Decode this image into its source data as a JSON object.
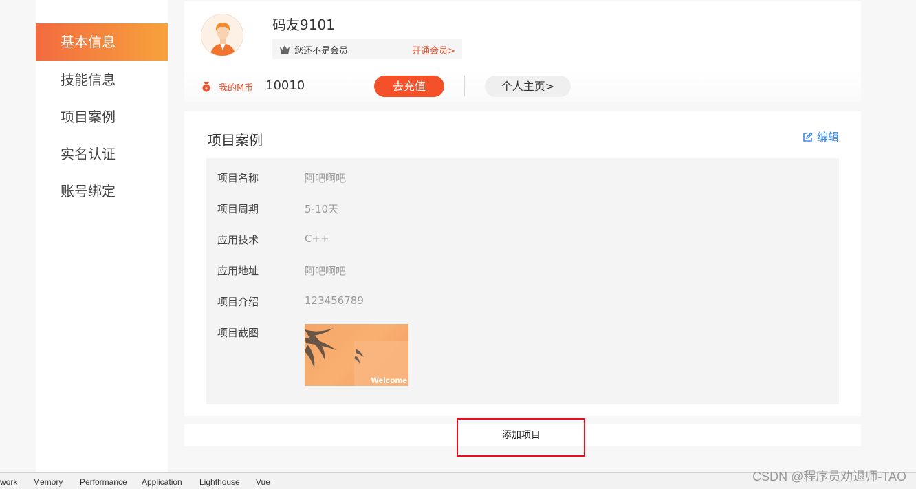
{
  "sidebar": {
    "items": [
      {
        "label": "基本信息",
        "active": true
      },
      {
        "label": "技能信息",
        "active": false
      },
      {
        "label": "项目案例",
        "active": false
      },
      {
        "label": "实名认证",
        "active": false
      },
      {
        "label": "账号绑定",
        "active": false
      }
    ]
  },
  "profile": {
    "username": "码友9101",
    "member_status": "您还不是会员",
    "member_link": "开通会员>",
    "coin_label": "我的M币",
    "coin_value": "10010",
    "recharge_label": "去充值",
    "homepage_label": "个人主页>"
  },
  "project": {
    "section_title": "项目案例",
    "edit_label": "编辑",
    "fields": [
      {
        "label": "项目名称",
        "value": "阿吧啊吧"
      },
      {
        "label": "项目周期",
        "value": "5-10天"
      },
      {
        "label": "应用技术",
        "value": "C++"
      },
      {
        "label": "应用地址",
        "value": "阿吧啊吧"
      },
      {
        "label": "项目介绍",
        "value": "123456789"
      },
      {
        "label": "项目截图",
        "value": ""
      }
    ],
    "screenshot_text": "Welcome",
    "add_label": "添加项目"
  },
  "devtools": {
    "tabs": [
      "work",
      "Memory",
      "Performance",
      "Application",
      "Lighthouse",
      "Vue"
    ]
  },
  "watermark": "CSDN @程序员劝退师-TAO",
  "colors": {
    "accent": "#f4502a",
    "sidebar_gradient_start": "#f26b3f",
    "sidebar_gradient_end": "#f7a23c",
    "link_blue": "#3b8be8",
    "highlight_red": "#e8101b"
  },
  "icons": [
    "crown-icon",
    "coin-icon",
    "edit-icon",
    "avatar"
  ]
}
